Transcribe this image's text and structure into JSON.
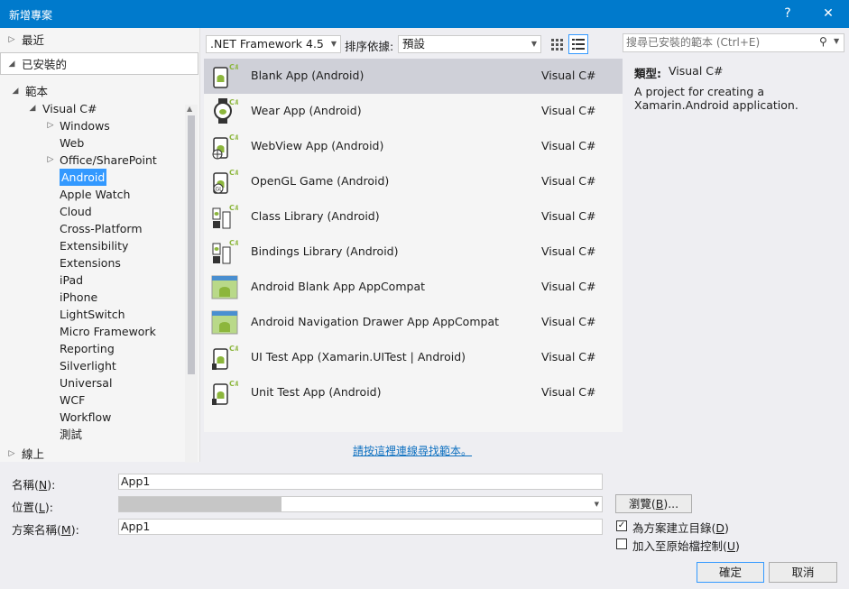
{
  "window": {
    "title": "新增專案",
    "help_glyph": "?",
    "close_glyph": "✕"
  },
  "left": {
    "recent": "最近",
    "installed": "已安裝的",
    "templates": "範本",
    "visual_csharp": "Visual C#",
    "items": [
      "Windows",
      "Web",
      "Office/SharePoint",
      "Android",
      "Apple Watch",
      "Cloud",
      "Cross-Platform",
      "Extensibility",
      "Extensions",
      "iPad",
      "iPhone",
      "LightSwitch",
      "Micro Framework",
      "Reporting",
      "Silverlight",
      "Universal",
      "WCF",
      "Workflow",
      "測試"
    ],
    "online": "線上"
  },
  "toolbar": {
    "framework": ".NET Framework 4.5",
    "sort_label": "排序依據:",
    "sort_value": "預設",
    "search_placeholder": "搜尋已安裝的範本 (Ctrl+E)"
  },
  "templates": [
    {
      "name": "Blank App (Android)",
      "lang": "Visual C#",
      "icon": "android-phone-icon"
    },
    {
      "name": "Wear App (Android)",
      "lang": "Visual C#",
      "icon": "android-watch-icon"
    },
    {
      "name": "WebView App (Android)",
      "lang": "Visual C#",
      "icon": "android-webview-icon"
    },
    {
      "name": "OpenGL Game (Android)",
      "lang": "Visual C#",
      "icon": "android-opengl-icon"
    },
    {
      "name": "Class Library (Android)",
      "lang": "Visual C#",
      "icon": "android-class-library-icon"
    },
    {
      "name": "Bindings Library (Android)",
      "lang": "Visual C#",
      "icon": "android-bindings-library-icon"
    },
    {
      "name": "Android Blank App AppCompat",
      "lang": "Visual C#",
      "icon": "android-appcompat-icon"
    },
    {
      "name": "Android Navigation Drawer App AppCompat",
      "lang": "Visual C#",
      "icon": "android-appcompat-drawer-icon"
    },
    {
      "name": "UI Test App (Xamarin.UITest | Android)",
      "lang": "Visual C#",
      "icon": "android-uitest-icon"
    },
    {
      "name": "Unit Test App (Android)",
      "lang": "Visual C#",
      "icon": "android-unittest-icon"
    }
  ],
  "details": {
    "type_label": "類型:",
    "type_value": "Visual C#",
    "description": "A project for creating a Xamarin.Android application."
  },
  "online_link": "請按這裡連線尋找範本。",
  "form": {
    "name_label": "名稱(",
    "name_key": "N",
    "name_value": "App1",
    "location_label": "位置(",
    "location_key": "L",
    "solution_label": "方案名稱(",
    "solution_key": "M",
    "solution_value": "App1",
    "label_close": "):",
    "browse_label": "瀏覽(",
    "browse_key": "B",
    "browse_close": ")...",
    "create_dir_label": "為方案建立目錄(",
    "create_dir_key": "D",
    "create_dir_checked": true,
    "source_control_label": "加入至原始檔控制(",
    "source_control_key": "U",
    "source_control_checked": false,
    "paren_close": ")",
    "ok": "確定",
    "cancel": "取消"
  },
  "colors": {
    "accent": "#007acc",
    "selection": "#3399ff",
    "android_green": "#8cb63c"
  }
}
